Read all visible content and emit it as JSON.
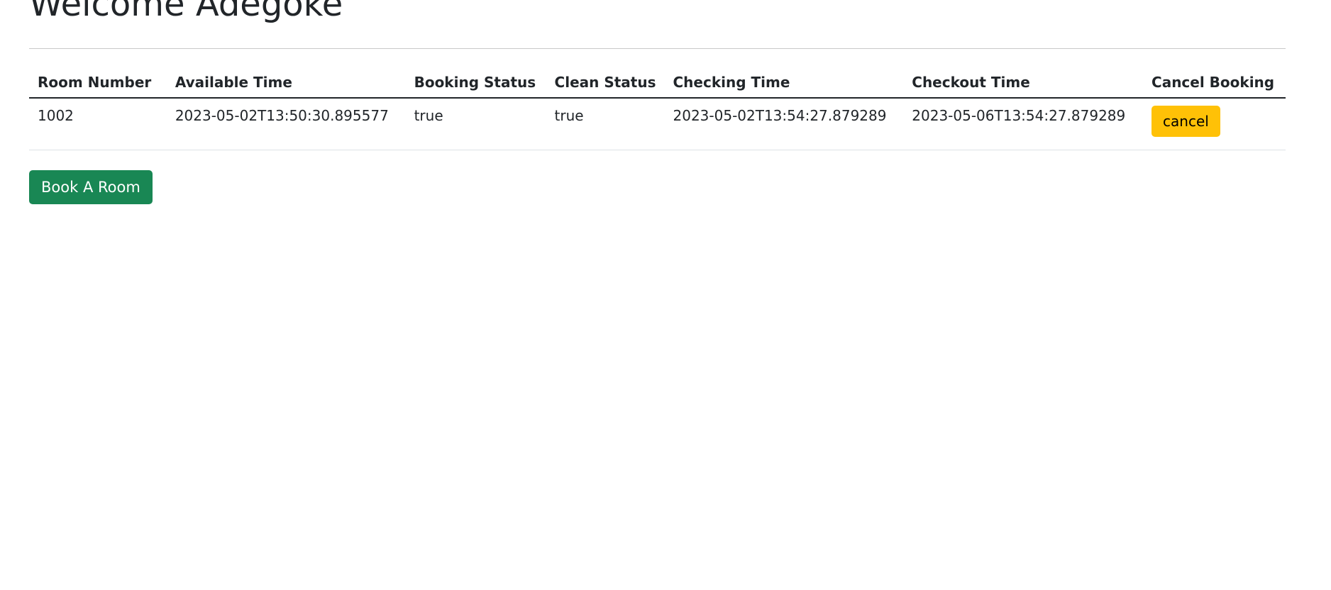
{
  "header": {
    "title": "Welcome Adegoke"
  },
  "table": {
    "columns": [
      "Room Number",
      "Available Time",
      "Booking Status",
      "Clean Status",
      "Checking Time",
      "Checkout Time",
      "Cancel Booking"
    ],
    "rows": [
      {
        "room_number": "1002",
        "available_time": "2023-05-02T13:50:30.895577",
        "booking_status": "true",
        "clean_status": "true",
        "checking_time": "2023-05-02T13:54:27.879289",
        "checkout_time": "2023-05-06T13:54:27.879289",
        "cancel_label": "cancel"
      }
    ]
  },
  "actions": {
    "book_room_label": "Book A Room"
  },
  "colors": {
    "cancel_button": "#ffc107",
    "book_button": "#198754"
  }
}
